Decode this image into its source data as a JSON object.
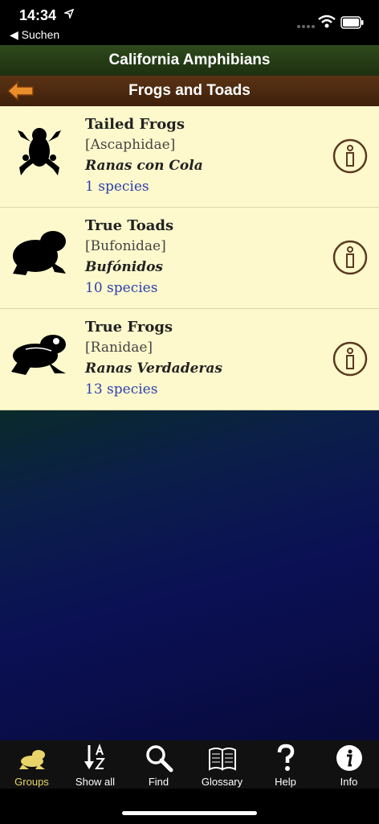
{
  "status": {
    "time": "14:34",
    "back_app": "◀ Suchen"
  },
  "header": {
    "app_title": "California Amphibians",
    "section_title": "Frogs and Toads"
  },
  "groups": [
    {
      "name": "Tailed Frogs",
      "family": "[Ascaphidae]",
      "spanish": "Ranas con Cola",
      "count": "1 species",
      "icon": "tailed-frog-silhouette"
    },
    {
      "name": "True Toads",
      "family": "[Bufonidae]",
      "spanish": "Bufónidos",
      "count": "10 species",
      "icon": "toad-silhouette"
    },
    {
      "name": "True Frogs",
      "family": "[Ranidae]",
      "spanish": "Ranas Verdaderas",
      "count": "13 species",
      "icon": "frog-silhouette"
    }
  ],
  "tabs": [
    {
      "label": "Groups",
      "icon": "frog-icon"
    },
    {
      "label": "Show all",
      "icon": "sort-az-icon"
    },
    {
      "label": "Find",
      "icon": "search-icon"
    },
    {
      "label": "Glossary",
      "icon": "book-icon"
    },
    {
      "label": "Help",
      "icon": "question-icon"
    },
    {
      "label": "Info",
      "icon": "info-icon"
    }
  ],
  "colors": {
    "row_bg": "#fdf9cc",
    "count_blue": "#2c3fb0",
    "accent_brown": "#5a3315",
    "active_tab": "#e9d46a"
  }
}
